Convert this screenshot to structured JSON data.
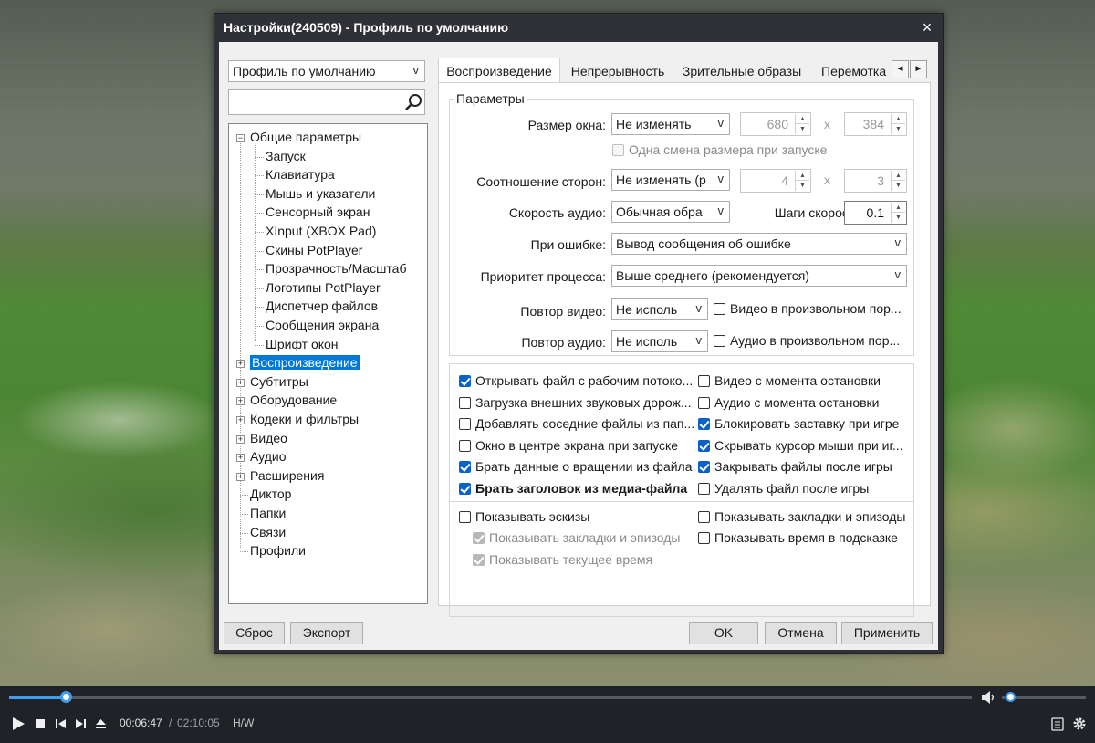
{
  "window": {
    "title": "Настройки(240509) - Профиль по умолчанию",
    "close": "×"
  },
  "profile_select": {
    "value": "Профиль по умолчанию",
    "arrow": "v"
  },
  "search": {
    "value": "",
    "placeholder": ""
  },
  "tree": {
    "general": "Общие параметры",
    "children": [
      "Запуск",
      "Клавиатура",
      "Мышь и указатели",
      "Сенсорный экран",
      "XInput (XBOX Pad)",
      "Скины PotPlayer",
      "Прозрачность/Масштаб",
      "Логотипы PotPlayer",
      "Диспетчер файлов",
      "Сообщения экрана",
      "Шрифт окон"
    ],
    "top": [
      "Воспроизведение",
      "Субтитры",
      "Оборудование",
      "Кодеки и фильтры",
      "Видео",
      "Аудио",
      "Расширения",
      "Диктор",
      "Папки",
      "Связи",
      "Профили"
    ],
    "selected": "Воспроизведение",
    "collapsed_sign": "+",
    "expanded_sign": "−"
  },
  "tabs": [
    "Воспроизведение",
    "Непрерывность",
    "Зрительные образы",
    "Перемотка"
  ],
  "tab_scroll": {
    "left": "◄",
    "right": "►"
  },
  "params": {
    "group_title": "Параметры",
    "window_size_label": "Размер окна:",
    "window_size_value": "Не изменять",
    "width": "680",
    "height": "384",
    "x": "x",
    "one_resize": "Одна смена размера при запуске",
    "aspect_label": "Соотношение сторон:",
    "aspect_value": "Не изменять (р",
    "aspect_w": "4",
    "aspect_h": "3",
    "audio_speed_label": "Скорость аудио:",
    "audio_speed_value": "Обычная обра",
    "speed_step_label": "Шаги скорости:",
    "speed_step_value": "0.1",
    "on_error_label": "При ошибке:",
    "on_error_value": "Вывод сообщения об ошибке",
    "priority_label": "Приоритет процесса:",
    "priority_value": "Выше среднего (рекомендуется)",
    "repeat_video_label": "Повтор видео:",
    "repeat_video_value": "Не исполь",
    "random_video": "Видео в произвольном пор...",
    "repeat_audio_label": "Повтор аудио:",
    "repeat_audio_value": "Не исполь",
    "random_audio": "Аудио в произвольном пор...",
    "arrow": "v",
    "spin_up": "▲",
    "spin_down": "▼"
  },
  "options_left": [
    {
      "label": "Открывать файл с рабочим потоко...",
      "checked": true
    },
    {
      "label": "Загрузка внешних звуковых дорож...",
      "checked": false
    },
    {
      "label": "Добавлять соседние файлы из пап...",
      "checked": false
    },
    {
      "label": "Окно в центре экрана при запуске",
      "checked": false
    },
    {
      "label": "Брать данные о вращении из файла",
      "checked": true
    },
    {
      "label": "Брать заголовок из медиа-файла",
      "checked": true
    }
  ],
  "options_right": [
    {
      "label": "Видео с момента остановки",
      "checked": false
    },
    {
      "label": "Аудио с момента остановки",
      "checked": false
    },
    {
      "label": "Блокировать заставку при игре",
      "checked": true
    },
    {
      "label": "Скрывать курсор мыши при иг...",
      "checked": true
    },
    {
      "label": "Закрывать файлы после игры",
      "checked": true
    },
    {
      "label": "Удалять файл после игры",
      "checked": false
    }
  ],
  "thumbs": {
    "show_thumbs": "Показывать эскизы",
    "show_bookmarks_sub": "Показывать закладки и эпизоды",
    "show_current_time": "Показывать текущее время",
    "show_bookmarks": "Показывать закладки и эпизоды",
    "show_time_tooltip": "Показывать время в подсказке"
  },
  "buttons": {
    "reset": "Сброс",
    "export": "Экспорт",
    "ok": "OK",
    "cancel": "Отмена",
    "apply": "Применить"
  },
  "player": {
    "current_time": "00:06:47",
    "separator": "/",
    "total_time": "02:10:05",
    "hw": "H/W",
    "progress": 0.06,
    "volume": 0.04,
    "icons": [
      "play-icon",
      "stop-icon",
      "prev-icon",
      "next-icon",
      "eject-icon",
      "volume-icon",
      "playlist-icon",
      "settings-icon"
    ]
  },
  "colors": {
    "accent": "#0078d7",
    "check": "#0a62c9",
    "seek": "#3d9df0",
    "title_bg": "#2f3136",
    "player_bg": "#1f2227"
  }
}
